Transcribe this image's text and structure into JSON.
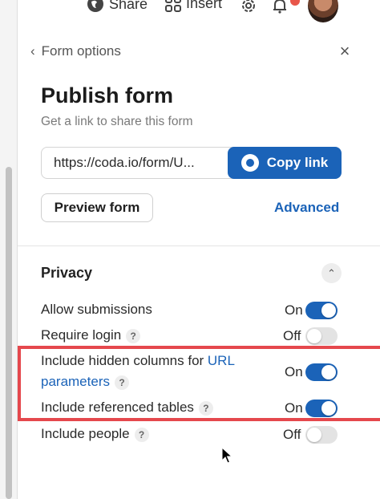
{
  "toolbar": {
    "share_label": "Share",
    "insert_label": "Insert",
    "share_icon": "globe-icon",
    "insert_icon": "grid-icon",
    "settings_icon": "gear-icon",
    "notifications_icon": "bell-icon"
  },
  "panel": {
    "back_label": "Form options",
    "title": "Publish form",
    "subtitle": "Get a link to share this form",
    "url_value": "https://coda.io/form/U...",
    "copy_label": "Copy link",
    "preview_label": "Preview form",
    "advanced_label": "Advanced"
  },
  "privacy": {
    "title": "Privacy",
    "options": [
      {
        "label": "Allow submissions",
        "state": "On",
        "help": ""
      },
      {
        "label": "Require login",
        "state": "Off",
        "help": "?"
      },
      {
        "label_prefix": "Include hidden columns for ",
        "label_link": "URL parameters",
        "state": "On",
        "help": "?"
      },
      {
        "label": "Include referenced tables",
        "state": "On",
        "help": "?"
      },
      {
        "label": "Include people",
        "state": "Off",
        "help": "?"
      }
    ]
  },
  "colors": {
    "accent": "#1b63b8",
    "highlight": "#e5484d",
    "notification_dot": "#e8564a"
  }
}
